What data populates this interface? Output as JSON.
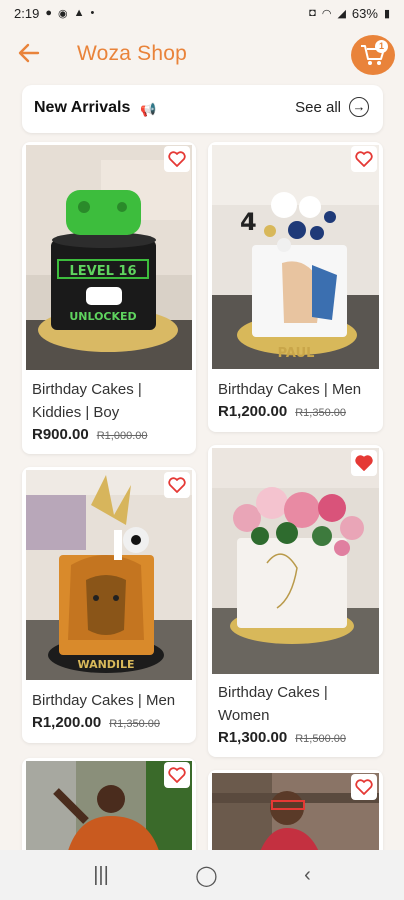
{
  "status": {
    "time": "2:19",
    "battery": "63%"
  },
  "header": {
    "title": "Woza Shop",
    "cart_count": "1"
  },
  "section": {
    "title": "New Arrivals",
    "see_all": "See all"
  },
  "products": [
    {
      "name_line1": "Birthday Cakes |",
      "name_line2": "Kiddies | Boy",
      "price": "R900.00",
      "old_price": "R1,000.00",
      "cake_text_1": "LEVEL 16",
      "cake_text_2": "UNLOCKED",
      "favorited": false
    },
    {
      "name_line1": "Birthday Cakes | Men",
      "price": "R1,200.00",
      "old_price": "R1,350.00",
      "cake_text_1": "PAUL",
      "favorited": false
    },
    {
      "name_line1": "Birthday Cakes | Men",
      "price": "R1,200.00",
      "old_price": "R1,350.00",
      "cake_text_1": "WANDILE",
      "favorited": false
    },
    {
      "name_line1": "Birthday Cakes |",
      "name_line2": "Women",
      "price": "R1,300.00",
      "old_price": "R1,500.00",
      "favorited": true
    },
    {
      "favorited": false
    },
    {
      "favorited": false
    }
  ],
  "colors": {
    "accent": "#e9833a",
    "fav_active": "#e53935"
  },
  "icons": {
    "back": "arrow-left-icon",
    "cart": "cart-icon",
    "see_all": "arrow-right-circle-icon",
    "favorite": "heart-icon"
  }
}
